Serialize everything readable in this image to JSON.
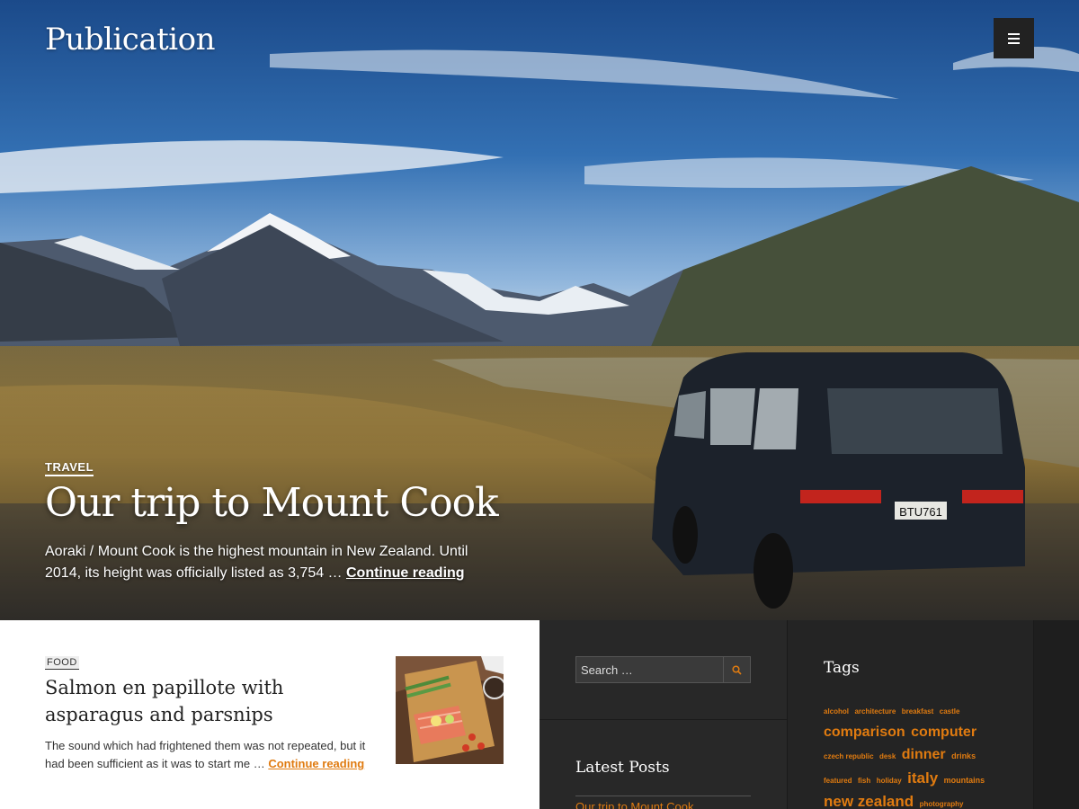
{
  "site": {
    "title": "Publication"
  },
  "header": {
    "menu_label": "menu"
  },
  "hero": {
    "category": "TRAVEL",
    "title": "Our trip to Mount Cook",
    "excerpt": "Aoraki / Mount Cook is the highest mountain in New Zealand. Until 2014, its height was officially listed as 3,754 … ",
    "more": "Continue reading",
    "plate": "BTU761"
  },
  "post": {
    "category": "FOOD",
    "title": "Salmon en papillote with asparagus and parsnips",
    "excerpt": "The sound which had frightened them was not repeated, but it had been sufficient as it was to start me … ",
    "more": "Continue reading"
  },
  "sidebar": {
    "search": {
      "placeholder": "Search …"
    },
    "latest_posts": {
      "title": "Latest Posts",
      "items": [
        "Our trip to Mount Cook"
      ]
    },
    "tags": {
      "title": "Tags",
      "rows": [
        [
          "alcohol",
          "architecture",
          "breakfast",
          "castle"
        ],
        [
          "comparison",
          "computer"
        ],
        [
          "czech republic",
          "desk",
          "dinner",
          "drinks"
        ],
        [
          "featured",
          "fish",
          "holiday",
          "italy",
          "mountains"
        ],
        [
          "new zealand",
          "photography"
        ]
      ]
    }
  },
  "colors": {
    "accent": "#e07b10",
    "sidebar_bg": "#282828",
    "menu_button": "#222222"
  }
}
